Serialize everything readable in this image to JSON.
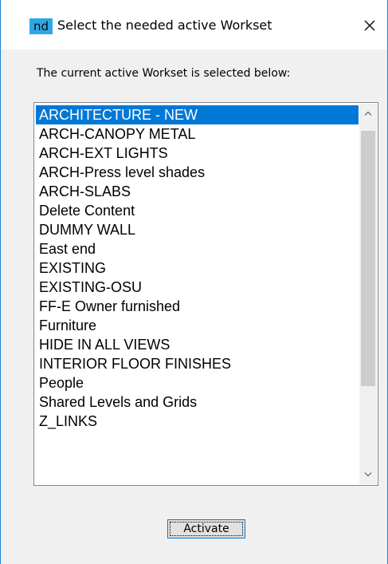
{
  "window": {
    "app_badge": "nd",
    "title": "Select the needed active Workset",
    "close_glyph": "✕"
  },
  "prompt": "The current active Workset is selected below:",
  "worksets": [
    {
      "label": "ARCHITECTURE - NEW",
      "selected": true
    },
    {
      "label": "ARCH-CANOPY METAL",
      "selected": false
    },
    {
      "label": "ARCH-EXT LIGHTS",
      "selected": false
    },
    {
      "label": "ARCH-Press level shades",
      "selected": false
    },
    {
      "label": "ARCH-SLABS",
      "selected": false
    },
    {
      "label": "Delete Content",
      "selected": false
    },
    {
      "label": "DUMMY WALL",
      "selected": false
    },
    {
      "label": "East end",
      "selected": false
    },
    {
      "label": "EXISTING",
      "selected": false
    },
    {
      "label": "EXISTING-OSU",
      "selected": false
    },
    {
      "label": "FF-E Owner furnished",
      "selected": false
    },
    {
      "label": "Furniture",
      "selected": false
    },
    {
      "label": "HIDE IN ALL VIEWS",
      "selected": false
    },
    {
      "label": "INTERIOR FLOOR FINISHES",
      "selected": false
    },
    {
      "label": "People",
      "selected": false
    },
    {
      "label": "Shared Levels and Grids",
      "selected": false
    },
    {
      "label": "Z_LINKS",
      "selected": false
    }
  ],
  "activate_label": "Activate",
  "icons": {
    "close": "close-icon",
    "scroll_up": "chevron-up-icon",
    "scroll_down": "chevron-down-icon"
  },
  "colors": {
    "accent": "#0078d7",
    "badge": "#2ea7e8",
    "window_border": "#1883d7",
    "dialog_bg": "#f0f0f0"
  }
}
